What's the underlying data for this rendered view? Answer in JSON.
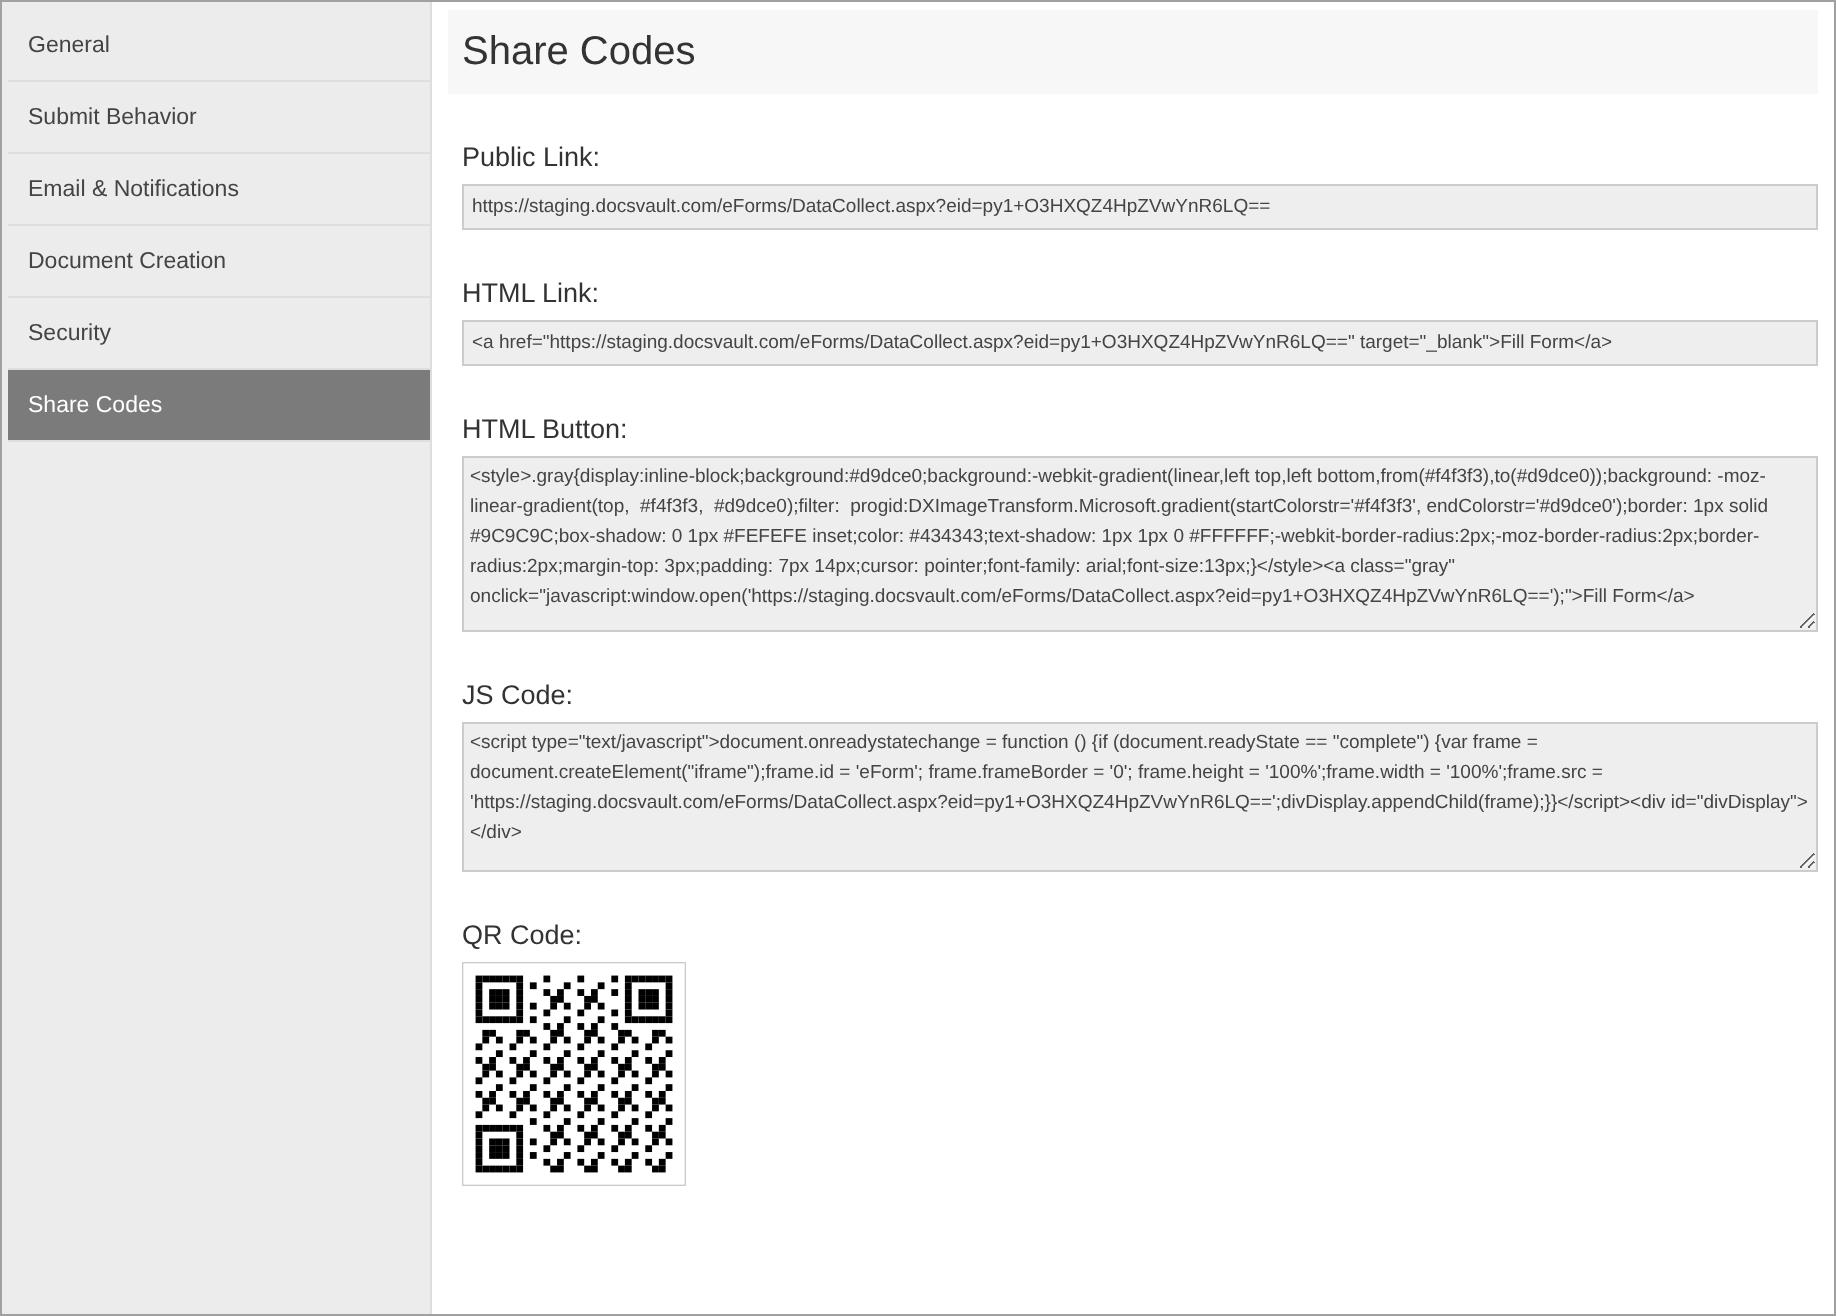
{
  "sidebar": {
    "items": [
      {
        "label": "General",
        "selected": false
      },
      {
        "label": "Submit Behavior",
        "selected": false
      },
      {
        "label": "Email & Notifications",
        "selected": false
      },
      {
        "label": "Document Creation",
        "selected": false
      },
      {
        "label": "Security",
        "selected": false
      },
      {
        "label": "Share Codes",
        "selected": true
      }
    ]
  },
  "page_title": "Share Codes",
  "fields": [
    {
      "kind": "line",
      "label": "Public Link:",
      "value": "https://staging.docsvault.com/eForms/DataCollect.aspx?eid=py1+O3HXQZ4HpZVwYnR6LQ=="
    },
    {
      "kind": "line",
      "label": "HTML Link:",
      "value": "<a href=\"https://staging.docsvault.com/eForms/DataCollect.aspx?eid=py1+O3HXQZ4HpZVwYnR6LQ==\" target=\"_blank\">Fill Form</a>"
    },
    {
      "kind": "area",
      "label": "HTML Button:",
      "value": "<style>.gray{display:inline-block;background:#d9dce0;background:-webkit-gradient(linear,left top,left bottom,from(#f4f3f3),to(#d9dce0));background: -moz-linear-gradient(top,  #f4f3f3,  #d9dce0);filter:  progid:DXImageTransform.Microsoft.gradient(startColorstr='#f4f3f3', endColorstr='#d9dce0');border: 1px solid #9C9C9C;box-shadow: 0 1px #FEFEFE inset;color: #434343;text-shadow: 1px 1px 0 #FFFFFF;-webkit-border-radius:2px;-moz-border-radius:2px;border-radius:2px;margin-top: 3px;padding: 7px 14px;cursor: pointer;font-family: arial;font-size:13px;}</style><a class=\"gray\" onclick=\"javascript:window.open('https://staging.docsvault.com/eForms/DataCollect.aspx?eid=py1+O3HXQZ4HpZVwYnR6LQ==');\">Fill Form</a>"
    },
    {
      "kind": "area",
      "label": "JS Code:",
      "value": "<script type=\"text/javascript\">document.onreadystatechange = function () {if (document.readyState == \"complete\") {var frame = document.createElement(\"iframe\");frame.id = 'eForm'; frame.frameBorder = '0'; frame.height = '100%';frame.width = '100%';frame.src = 'https://staging.docsvault.com/eForms/DataCollect.aspx?eid=py1+O3HXQZ4HpZVwYnR6LQ==';divDisplay.appendChild(frame);}}</script><div id=\"divDisplay\"></div>"
    }
  ],
  "qr": {
    "label": "QR Code:"
  }
}
